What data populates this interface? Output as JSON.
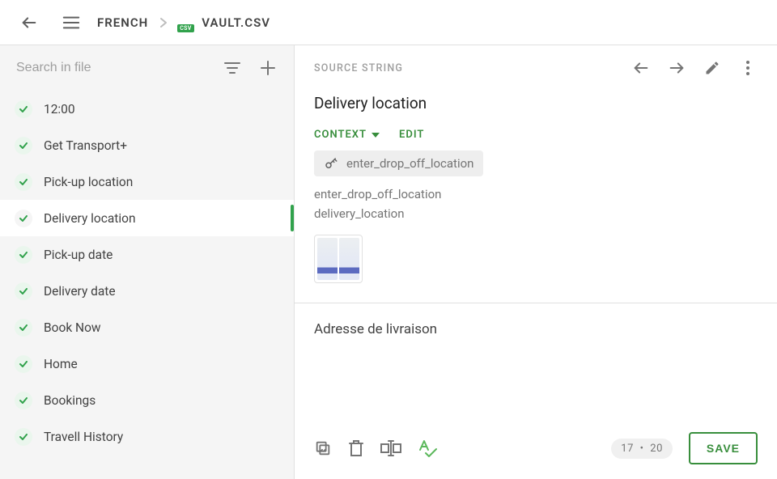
{
  "breadcrumb": {
    "language": "FRENCH",
    "filename": "VAULT.CSV",
    "file_badge": "CSV"
  },
  "search": {
    "placeholder": "Search in file"
  },
  "strings": [
    {
      "label": "12:00",
      "active": false
    },
    {
      "label": "Get Transport+",
      "active": false
    },
    {
      "label": "Pick-up location",
      "active": false
    },
    {
      "label": "Delivery location",
      "active": true
    },
    {
      "label": "Pick-up date",
      "active": false
    },
    {
      "label": "Delivery date",
      "active": false
    },
    {
      "label": "Book Now",
      "active": false
    },
    {
      "label": "Home",
      "active": false
    },
    {
      "label": "Bookings",
      "active": false
    },
    {
      "label": "Travell History",
      "active": false
    }
  ],
  "source": {
    "section_label": "SOURCE STRING",
    "title": "Delivery location",
    "context_label": "CONTEXT",
    "edit_label": "EDIT",
    "key": "enter_drop_off_location",
    "extra_keys": [
      "enter_drop_off_location",
      "delivery_location"
    ]
  },
  "translation": {
    "text": "Adresse de livraison"
  },
  "footer": {
    "char_count": "17",
    "char_sep": "•",
    "char_limit": "20",
    "save_label": "SAVE"
  }
}
